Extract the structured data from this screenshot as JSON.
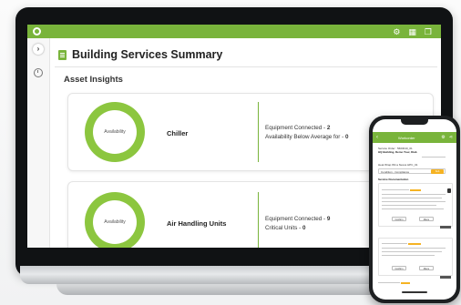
{
  "app": {
    "page_title": "Building Services Summary",
    "section_title": "Asset Insights",
    "rail_expand_icon": "chevron-right-icon",
    "top_icons": [
      "gear-icon",
      "grid-icon",
      "window-icon"
    ]
  },
  "cards": [
    {
      "name": "Chiller",
      "donut_label": "Availability",
      "stat1_label": "Equipment Connected - ",
      "stat1_value": "2",
      "stat2_label": "Availability Below Average for - ",
      "stat2_value": "0"
    },
    {
      "name": "Air Handling Units",
      "donut_label": "Availability",
      "stat1_label": "Equipment Connected - ",
      "stat1_value": "9",
      "stat2_label": "Critical Units - ",
      "stat2_value": "0"
    }
  ],
  "phone": {
    "header_title": "Workorder",
    "line1": "Service Order : 5603010_01",
    "line2": "HQ Building, Demo Tour, Diab",
    "line3": "Heat Wrap Wit a Nexus HPC_01",
    "field1": "Condition - Compliance",
    "chip1": "Sub",
    "line4": "Service Documentation",
    "btn1": "Confirm",
    "btn2": "Menu",
    "btn3": "Confirm",
    "btn4": "Menu"
  },
  "colors": {
    "brand_green": "#79b43b",
    "donut_green": "#8cc63f",
    "highlight_orange": "#f5b323"
  }
}
